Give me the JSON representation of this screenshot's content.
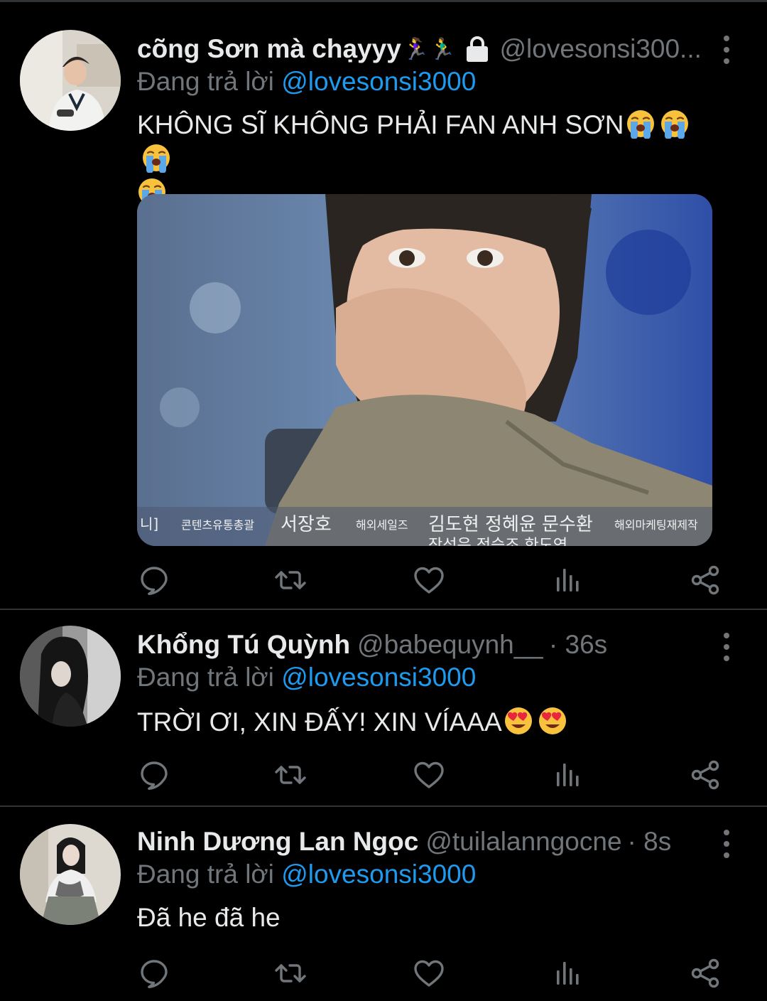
{
  "colors": {
    "background": "#000000",
    "text_primary": "#e7e9ea",
    "text_secondary": "#71767b",
    "mention_blue": "#1d9bf0",
    "divider": "#2f3336"
  },
  "tweets": [
    {
      "display_name": "cõng Sơn mà chạyyy",
      "name_emoji": "🏃‍♀️🏃‍♂️",
      "protected": true,
      "handle": "@lovesonsi300...",
      "time": "",
      "replying_prefix": "Đang trả lời",
      "replying_to": "@lovesonsi3000",
      "text": "KHÔNG SĨ KHÔNG PHẢI FAN ANH SƠN",
      "text_emojis": [
        "loudly-crying-face",
        "loudly-crying-face",
        "loudly-crying-face",
        "loudly-crying-face"
      ],
      "media": {
        "type": "image",
        "credits": [
          "니]",
          "콘텐츠유통총괄",
          "서장호",
          "해외세일즈",
          "김도현 정혜윤 문수환",
          "해외마케팅재제작",
          "작성은 정승조 한도연"
        ]
      },
      "actions": [
        "reply-icon",
        "retweet-icon",
        "like-icon",
        "analytics-icon",
        "share-icon"
      ]
    },
    {
      "display_name": "Khổng Tú Quỳnh",
      "handle": "@babequynh__",
      "time": "· 36s",
      "replying_prefix": "Đang trả lời",
      "replying_to": "@lovesonsi3000",
      "text": "TRỜI ƠI, XIN ĐẤY! XIN VÍAAA",
      "text_emojis": [
        "heart-eyes-face",
        "heart-eyes-face"
      ],
      "actions": [
        "reply-icon",
        "retweet-icon",
        "like-icon",
        "analytics-icon",
        "share-icon"
      ]
    },
    {
      "display_name": "Ninh Dương Lan Ngọc",
      "handle": "@tuilalanngocne",
      "time": "· 8s",
      "replying_prefix": "Đang trả lời",
      "replying_to": "@lovesonsi3000",
      "text": "Đã he đã he",
      "text_emojis": [],
      "actions": [
        "reply-icon",
        "retweet-icon",
        "like-icon",
        "analytics-icon",
        "share-icon"
      ]
    }
  ]
}
